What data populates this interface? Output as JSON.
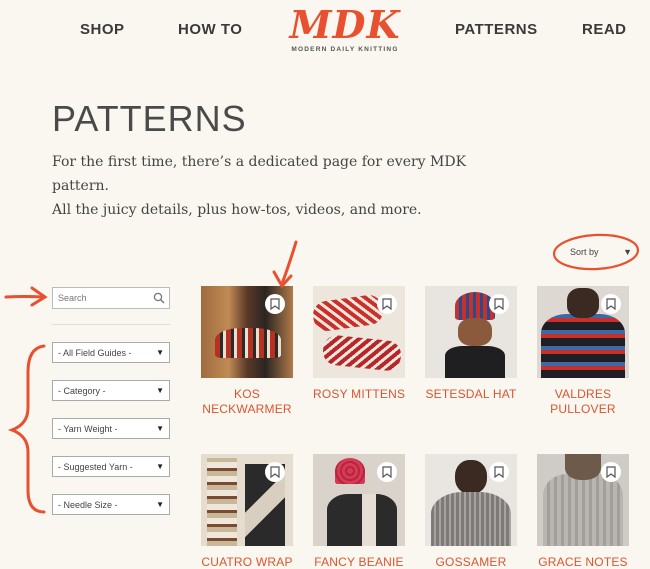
{
  "nav": {
    "shop": "SHOP",
    "howto": "HOW TO",
    "patterns": "PATTERNS",
    "read": "READ",
    "logo_text": "MDK",
    "logo_sub": "MODERN DAILY KNITTING"
  },
  "page": {
    "title": "PATTERNS",
    "intro_line1": "For the first time, there’s a dedicated page for every MDK pattern.",
    "intro_line2": "All the juicy details, plus how-tos, videos, and more."
  },
  "sort": {
    "label": "Sort by"
  },
  "search": {
    "placeholder": "Search"
  },
  "filters": [
    "- All Field Guides -",
    "- Category -",
    "- Yarn Weight -",
    "- Suggested Yarn -",
    "- Needle Size -"
  ],
  "patterns": [
    {
      "line1": "KOS",
      "line2": "NECKWARMER"
    },
    {
      "line1": "ROSY MITTENS",
      "line2": ""
    },
    {
      "line1": "SETESDAL HAT",
      "line2": ""
    },
    {
      "line1": "VALDRES",
      "line2": "PULLOVER"
    },
    {
      "line1": "CUATRO WRAP",
      "line2": ""
    },
    {
      "line1": "FANCY BEANIE",
      "line2": ""
    },
    {
      "line1": "GOSSAMER",
      "line2": ""
    },
    {
      "line1": "GRACE NOTES",
      "line2": ""
    }
  ],
  "colors": {
    "accent": "#e8502f",
    "label": "#d9552f",
    "annotation": "#e8502f",
    "background": "#faf7f1"
  }
}
